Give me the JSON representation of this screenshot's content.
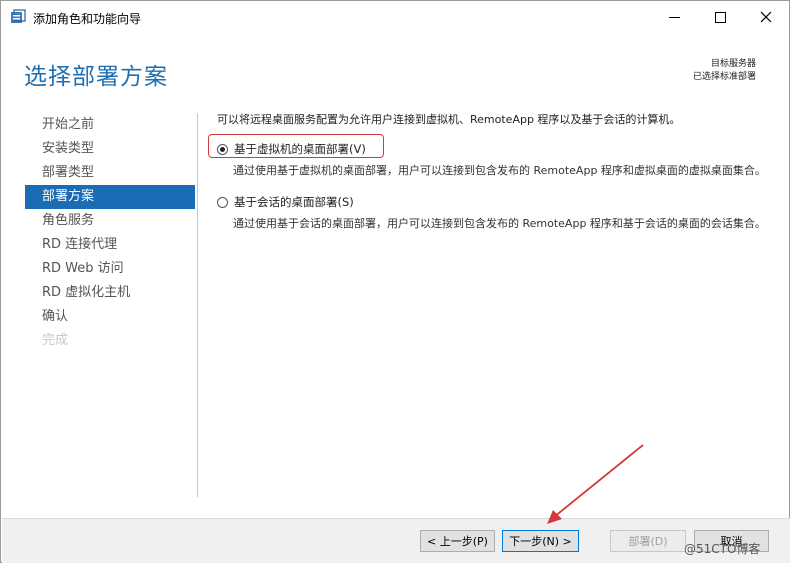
{
  "window": {
    "title": "添加角色和功能向导"
  },
  "header": {
    "page_title": "选择部署方案",
    "dest_line1": "目标服务器",
    "dest_line2": "已选择标准部署"
  },
  "nav": {
    "items": [
      {
        "label": "开始之前"
      },
      {
        "label": "安装类型"
      },
      {
        "label": "部署类型"
      },
      {
        "label": "部署方案"
      },
      {
        "label": "角色服务"
      },
      {
        "label": "RD 连接代理"
      },
      {
        "label": "RD Web 访问"
      },
      {
        "label": "RD 虚拟化主机"
      },
      {
        "label": "确认"
      },
      {
        "label": "完成"
      }
    ]
  },
  "content": {
    "intro": "可以将远程桌面服务配置为允许用户连接到虚拟机、RemoteApp 程序以及基于会话的计算机。",
    "option_vm": {
      "label": "基于虚拟机的桌面部署(V)",
      "desc": "通过使用基于虚拟机的桌面部署，用户可以连接到包含发布的 RemoteApp 程序和虚拟桌面的虚拟桌面集合。",
      "checked": true
    },
    "option_session": {
      "label": "基于会话的桌面部署(S)",
      "desc": "通过使用基于会话的桌面部署，用户可以连接到包含发布的 RemoteApp 程序和基于会话的桌面的会话集合。",
      "checked": false
    }
  },
  "footer": {
    "prev_label": "< 上一步(P)",
    "next_label": "下一步(N) >",
    "deploy_label": "部署(D)",
    "cancel_label": "取消"
  },
  "watermark": "@51CTO博客",
  "colors": {
    "accent": "#1a6db5",
    "title_blue": "#1f6fb0",
    "annotation_red": "#d23a3a"
  }
}
